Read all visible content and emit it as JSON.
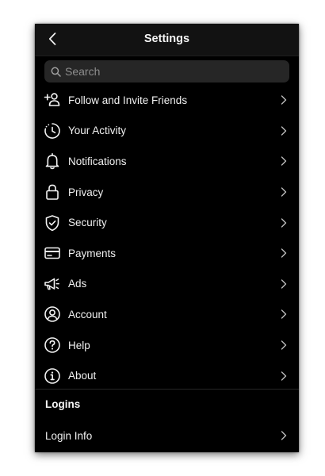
{
  "colors": {
    "background": "#000000",
    "header": "#121212",
    "search_bg": "#262626",
    "text": "#f0f0f0",
    "muted": "#8e8e8e"
  },
  "header": {
    "title": "Settings",
    "back_icon": "chevron-left-icon"
  },
  "search": {
    "placeholder": "Search",
    "value": "",
    "icon": "search-icon"
  },
  "menu": {
    "items": [
      {
        "label": "Follow and Invite Friends",
        "icon": "add-person-icon"
      },
      {
        "label": "Your Activity",
        "icon": "activity-icon"
      },
      {
        "label": "Notifications",
        "icon": "bell-icon"
      },
      {
        "label": "Privacy",
        "icon": "lock-icon"
      },
      {
        "label": "Security",
        "icon": "shield-icon"
      },
      {
        "label": "Payments",
        "icon": "credit-card-icon"
      },
      {
        "label": "Ads",
        "icon": "megaphone-icon"
      },
      {
        "label": "Account",
        "icon": "user-circle-icon"
      },
      {
        "label": "Help",
        "icon": "help-icon"
      },
      {
        "label": "About",
        "icon": "info-icon"
      }
    ]
  },
  "logins": {
    "section_label": "Logins",
    "items": [
      {
        "label": "Login Info",
        "icon": "chevron-right-icon"
      }
    ]
  }
}
